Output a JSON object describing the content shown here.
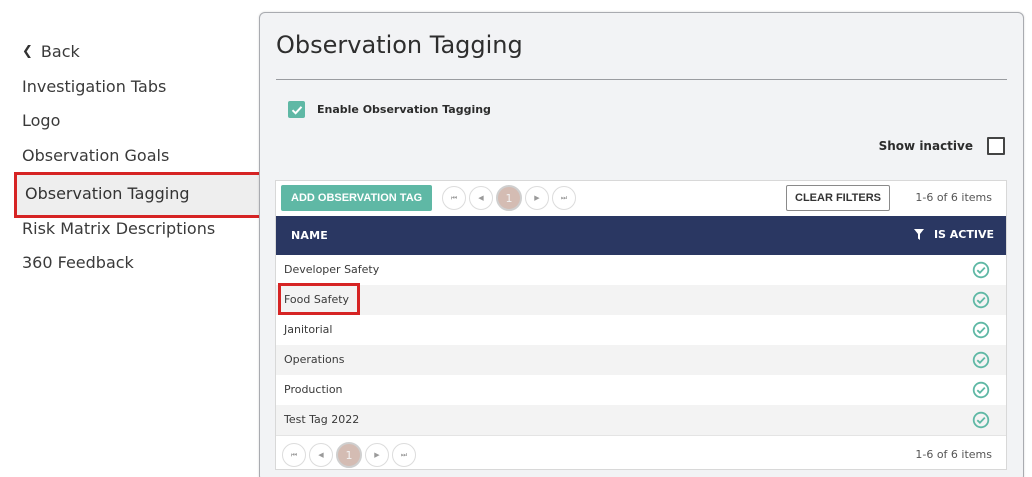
{
  "sidebar": {
    "back_label": "Back",
    "items": [
      {
        "label": "Investigation Tabs"
      },
      {
        "label": "Logo"
      },
      {
        "label": "Observation Goals"
      },
      {
        "label": "Observation Tagging"
      },
      {
        "label": "Risk Matrix Descriptions"
      },
      {
        "label": "360 Feedback"
      }
    ],
    "active_index": 3
  },
  "panel": {
    "title": "Observation Tagging",
    "enable_label": "Enable Observation Tagging",
    "enable_checked": true,
    "show_inactive_label": "Show inactive",
    "show_inactive_checked": false
  },
  "grid": {
    "add_button_label": "ADD OBSERVATION TAG",
    "clear_filters_label": "CLEAR FILTERS",
    "items_count": "1-6 of 6 items",
    "current_page": "1",
    "columns": {
      "name": "NAME",
      "is_active": "IS ACTIVE"
    },
    "rows": [
      {
        "name": "Developer Safety",
        "is_active": true
      },
      {
        "name": "Food Safety",
        "is_active": true
      },
      {
        "name": "Janitorial",
        "is_active": true
      },
      {
        "name": "Operations",
        "is_active": true
      },
      {
        "name": "Production",
        "is_active": true
      },
      {
        "name": "Test Tag 2022",
        "is_active": true
      }
    ],
    "highlighted_row_index": 1
  },
  "colors": {
    "accent": "#5fb8a5",
    "header": "#2a3762",
    "highlight": "#d62424"
  }
}
